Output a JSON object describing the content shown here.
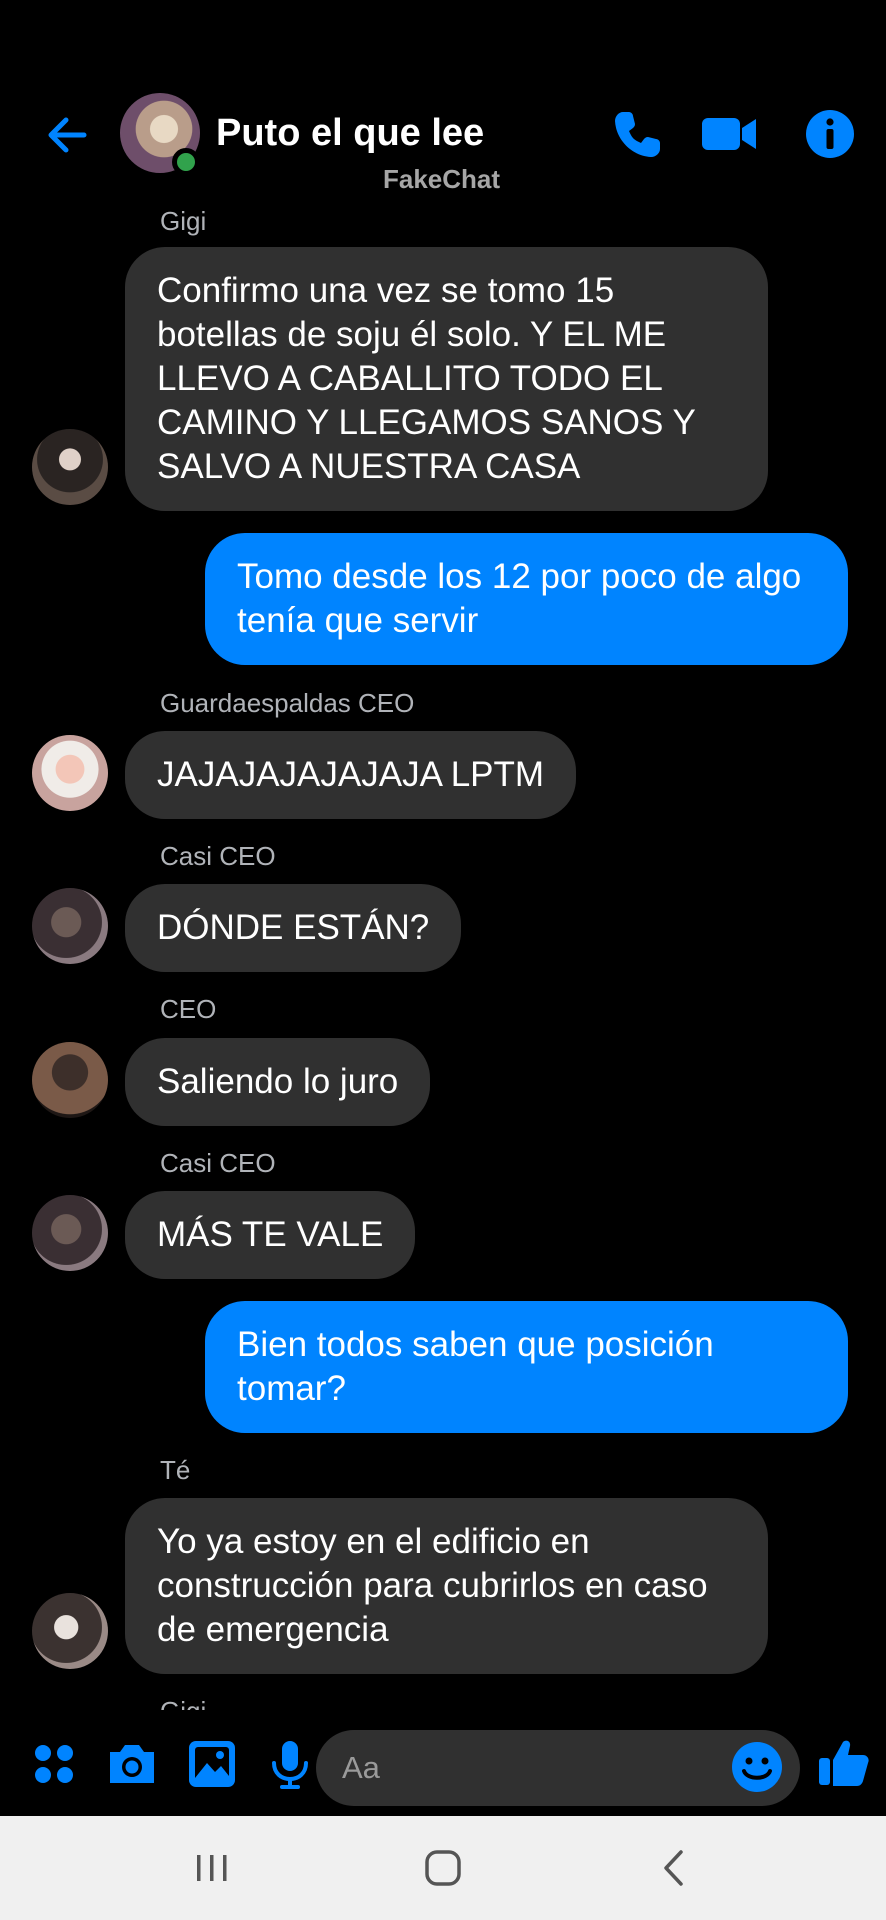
{
  "header": {
    "title": "Puto el que lee",
    "watermark": "FakeChat"
  },
  "colors": {
    "accent": "#0084ff",
    "incoming_bubble": "#303030",
    "background": "#000000",
    "online": "#31a24c"
  },
  "icons": {
    "back": "arrow-left-icon",
    "call": "phone-icon",
    "video": "video-camera-icon",
    "info": "info-icon",
    "more": "four-dots-icon",
    "camera": "camera-icon",
    "gallery": "image-icon",
    "mic": "microphone-icon",
    "emoji": "smiley-icon",
    "like": "thumbs-up-icon"
  },
  "messages": [
    {
      "sender": "Gigi",
      "text": "Confirmo una vez se tomo 15 botellas de soju él solo. Y EL ME LLEVO A CABALLITO TODO EL CAMINO Y LLEGAMOS SANOS Y SALVO A NUESTRA CASA"
    },
    {
      "text": "Tomo desde los 12 por poco de algo tenía que servir"
    },
    {
      "sender": "Guardaespaldas CEO",
      "text": "JAJAJAJAJAJAJA LPTM"
    },
    {
      "sender": "Casi CEO",
      "text": "DÓNDE ESTÁN?"
    },
    {
      "sender": "CEO",
      "text": "Saliendo lo juro"
    },
    {
      "sender": "Casi CEO",
      "text": "MÁS TE VALE"
    },
    {
      "text": "Bien todos saben que posición tomar?"
    },
    {
      "sender": "Té",
      "text": "Yo ya estoy en el edificio en construcción para cubrirlos en caso de emergencia"
    },
    {
      "sender": "Gigi"
    }
  ],
  "composer": {
    "placeholder": "Aa"
  }
}
